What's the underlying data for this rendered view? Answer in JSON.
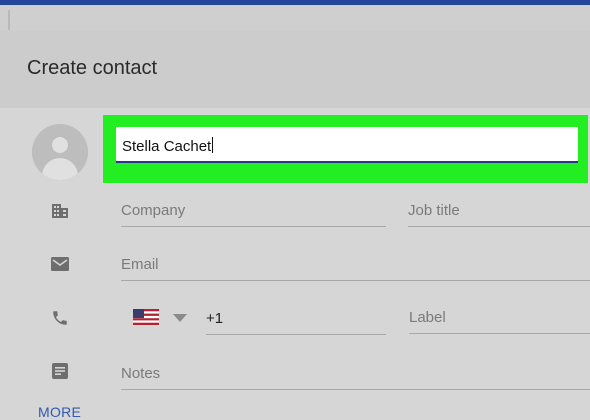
{
  "dialog": {
    "title": "Create contact"
  },
  "name_field": {
    "value": "Stella Cachet"
  },
  "company_field": {
    "placeholder": "Company"
  },
  "job_title_field": {
    "placeholder": "Job title"
  },
  "email_field": {
    "placeholder": "Email"
  },
  "phone": {
    "country_code": "+1",
    "country_flag": "us-flag-icon",
    "label_placeholder": "Label"
  },
  "notes_field": {
    "placeholder": "Notes"
  },
  "more_link": "MORE",
  "colors": {
    "highlight": "#22ee22",
    "link": "#2f5bb0",
    "focus_underline": "#26378f"
  }
}
